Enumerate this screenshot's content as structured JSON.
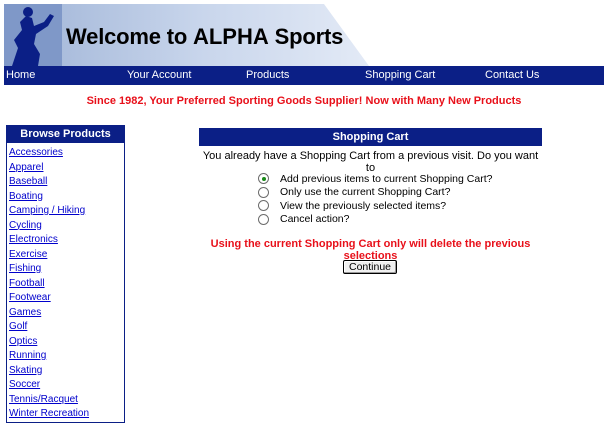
{
  "banner": {
    "title_prefix": "Welcome to ",
    "title_brand": "ALPHA",
    "title_suffix": " Sports"
  },
  "nav": {
    "items": [
      "Home",
      "Your Account",
      "Products",
      "Shopping Cart",
      "Contact Us"
    ]
  },
  "tagline": "Since 1982, Your Preferred Sporting Goods Supplier! Now with Many New Products",
  "browse": {
    "header": "Browse Products",
    "items": [
      "Accessories",
      "Apparel",
      "Baseball",
      "Boating",
      "Camping / Hiking",
      "Cycling",
      "Electronics",
      "Exercise",
      "Fishing",
      "Football",
      "Footwear",
      "Games",
      "Golf",
      "Optics",
      "Running",
      "Skating",
      "Soccer",
      "Tennis/Racquet",
      "Winter Recreation"
    ]
  },
  "cart": {
    "header": "Shopping Cart",
    "intro": "You already have a Shopping Cart from a previous visit. Do you want to",
    "options": [
      {
        "label": "Add previous items to current Shopping Cart?",
        "selected": true
      },
      {
        "label": "Only use the current Shopping Cart?",
        "selected": false
      },
      {
        "label": "View the previously selected items?",
        "selected": false
      },
      {
        "label": "Cancel action?",
        "selected": false
      }
    ],
    "warning": "Using the current Shopping Cart only will delete the previous selections",
    "continue_label": "Continue"
  },
  "colors": {
    "nav_bg": "#0b1f86",
    "alert_red": "#e8101a",
    "link_blue": "#0000cc"
  }
}
